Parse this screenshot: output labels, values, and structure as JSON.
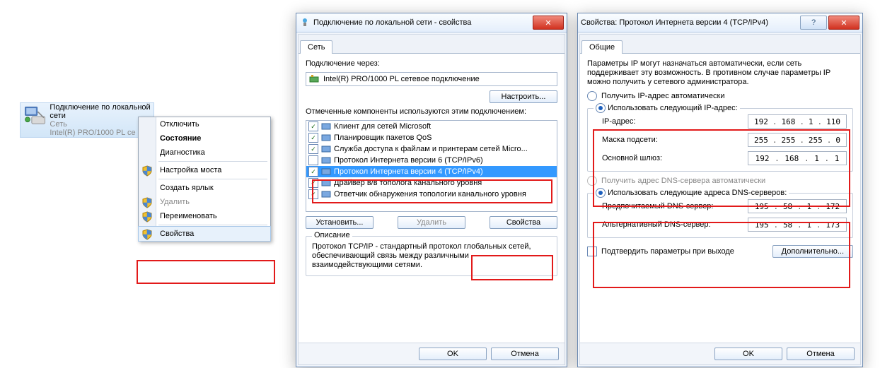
{
  "netcard": {
    "title": "Подключение по локальной сети",
    "sub1": "Сеть",
    "sub2": "Intel(R) PRO/1000 PL се"
  },
  "ctx": {
    "items": [
      {
        "label": "Отключить",
        "shield": false,
        "bold": false
      },
      {
        "label": "Состояние",
        "shield": false,
        "bold": true
      },
      {
        "label": "Диагностика",
        "shield": false,
        "bold": false
      },
      {
        "sep": true
      },
      {
        "label": "Настройка моста",
        "shield": true,
        "bold": false
      },
      {
        "sep": true
      },
      {
        "label": "Создать ярлык",
        "shield": false,
        "bold": false
      },
      {
        "label": "Удалить",
        "shield": true,
        "bold": false,
        "disabled": true
      },
      {
        "label": "Переименовать",
        "shield": true,
        "bold": false
      },
      {
        "sep": true
      },
      {
        "label": "Свойства",
        "shield": true,
        "bold": false,
        "hl": true
      }
    ]
  },
  "w1": {
    "title": "Подключение по локальной сети - свойства",
    "tab": "Сеть",
    "conn_via": "Подключение через:",
    "adapter": "Intel(R) PRO/1000 PL сетевое подключение",
    "configure": "Настроить...",
    "comp_label": "Отмеченные компоненты используются этим подключением:",
    "rows": [
      {
        "c": true,
        "label": "Клиент для сетей Microsoft"
      },
      {
        "c": true,
        "label": "Планировщик пакетов QoS"
      },
      {
        "c": true,
        "label": "Служба доступа к файлам и принтерам сетей Micro..."
      },
      {
        "c": false,
        "label": "Протокол Интернета версии 6 (TCP/IPv6)"
      },
      {
        "c": true,
        "label": "Протокол Интернета версии 4 (TCP/IPv4)",
        "sel": true
      },
      {
        "c": true,
        "label": "Драйвер в/в тополога канального уровня"
      },
      {
        "c": true,
        "label": "Ответчик обнаружения топологии канального уровня"
      }
    ],
    "install": "Установить...",
    "remove": "Удалить",
    "props": "Свойства",
    "desc_h": "Описание",
    "desc": "Протокол TCP/IP - стандартный протокол глобальных сетей, обеспечивающий связь между различными взаимодействующими сетями.",
    "ok": "OK",
    "cancel": "Отмена"
  },
  "w2": {
    "title": "Свойства: Протокол Интернета версии 4 (TCP/IPv4)",
    "tab": "Общие",
    "intro": "Параметры IP могут назначаться автоматически, если сеть поддерживает эту возможность. В противном случае параметры IP можно получить у сетевого администратора.",
    "r_auto_ip": "Получить IP-адрес автоматически",
    "r_man_ip": "Использовать следующий IP-адрес:",
    "ip_label": "IP-адрес:",
    "mask_label": "Маска подсети:",
    "gw_label": "Основной шлюз:",
    "ip": [
      "192",
      "168",
      "1",
      "110"
    ],
    "mask": [
      "255",
      "255",
      "255",
      "0"
    ],
    "gw": [
      "192",
      "168",
      "1",
      "1"
    ],
    "r_auto_dns": "Получить адрес DNS-сервера автоматически",
    "r_man_dns": "Использовать следующие адреса DNS-серверов:",
    "dns1_l": "Предпочитаемый DNS-сервер:",
    "dns2_l": "Альтернативный DNS-сервер:",
    "dns1": [
      "195",
      "58",
      "1",
      "172"
    ],
    "dns2": [
      "195",
      "58",
      "1",
      "173"
    ],
    "validate": "Подтвердить параметры при выходе",
    "adv": "Дополнительно...",
    "ok": "OK",
    "cancel": "Отмена"
  }
}
